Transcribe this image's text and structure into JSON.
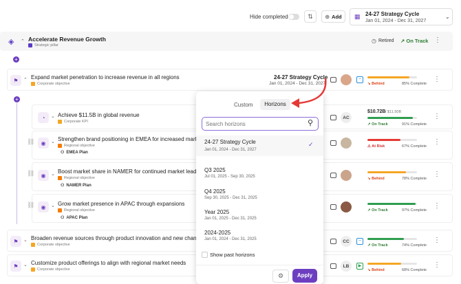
{
  "toolbar": {
    "hide_completed_label": "Hide completed",
    "add_label": "Add",
    "horizon_title": "24-27 Strategy Cycle",
    "horizon_dates": "Jan 01, 2024 - Dec 31, 2027"
  },
  "pillar": {
    "title": "Accelerate Revenue Growth",
    "type": "Strategic pillar",
    "retired_label": "Retired",
    "status": "On Track"
  },
  "objective_main": {
    "title": "Expand market penetration to increase revenue in all regions",
    "type": "Corporate objective",
    "horizon_title": "24-27 Strategy Cycle",
    "horizon_dates": "Jan 01, 2024 - Dec 31, 2027",
    "status": "Behind",
    "pct": "85% Complete",
    "progress": 0.85
  },
  "rows": [
    {
      "title": "Achieve $11.5B in global revenue",
      "type": "Corporate KPI",
      "type_color": "#f5a623",
      "avatar": "AC",
      "value": "$10.72B",
      "target": "/ $11.50B",
      "status": "On Track",
      "status_color": "#2e7d32",
      "pct": "91% Complete",
      "progress": 0.91,
      "bar_color": "#2e9d4f"
    },
    {
      "title": "Strengthen brand positioning in EMEA for increased market share",
      "type": "Regional objective",
      "type_color": "#f57c00",
      "plan": "EMEA Plan",
      "status": "At Risk",
      "status_color": "#d32f2f",
      "pct": "67% Complete",
      "progress": 0.67,
      "bar_color": "#e53935"
    },
    {
      "title": "Boost market share in NAMER for continued market leadership",
      "type": "Regional objective",
      "type_color": "#f57c00",
      "plan": "NAMER Plan",
      "status": "Behind",
      "status_color": "#d84315",
      "pct": "78% Complete",
      "progress": 0.78,
      "bar_color": "#f5a623"
    },
    {
      "title": "Grow market presence in APAC through expansions",
      "type": "Regional objective",
      "type_color": "#f57c00",
      "plan": "APAC Plan",
      "status": "On Track",
      "status_color": "#2e7d32",
      "pct": "97% Complete",
      "progress": 0.97,
      "bar_color": "#2e9d4f"
    }
  ],
  "bottom_rows": [
    {
      "title": "Broaden revenue sources through product innovation and new channels",
      "type": "Corporate objective",
      "avatar": "CC",
      "status": "On Track",
      "status_color": "#2e7d32",
      "pct": "74% Complete",
      "progress": 0.74,
      "bar_color": "#2e9d4f"
    },
    {
      "title": "Customize product offerings to align with regional market needs",
      "type": "Corporate objective",
      "avatar": "LB",
      "status": "Behind",
      "status_color": "#d84315",
      "pct": "68% Complete",
      "progress": 0.68,
      "bar_color": "#f5a623"
    }
  ],
  "dropdown": {
    "tabs": [
      "Custom",
      "Horizons"
    ],
    "search_placeholder": "Search horizons",
    "items": [
      {
        "title": "24-27 Strategy Cycle",
        "dates": "Jan 01, 2024 - Dec 31, 2027"
      },
      {
        "title": "Q3 2025",
        "dates": "Jul 01, 2025 - Sep 30, 2025"
      },
      {
        "title": "Q4 2025",
        "dates": "Sep 30, 2025 - Dec 31, 2025"
      },
      {
        "title": "Year 2025",
        "dates": "Jan 01, 2025 - Dec 31, 2025"
      },
      {
        "title": "2024-2025",
        "dates": "Jan 01, 2024 - Dec 31, 2025"
      }
    ],
    "show_past_label": "Show past horizons",
    "apply_label": "Apply"
  },
  "colors": {
    "accent": "#6d3fc0",
    "pillar": "#5b3cc4",
    "corporate": "#f5a623"
  }
}
